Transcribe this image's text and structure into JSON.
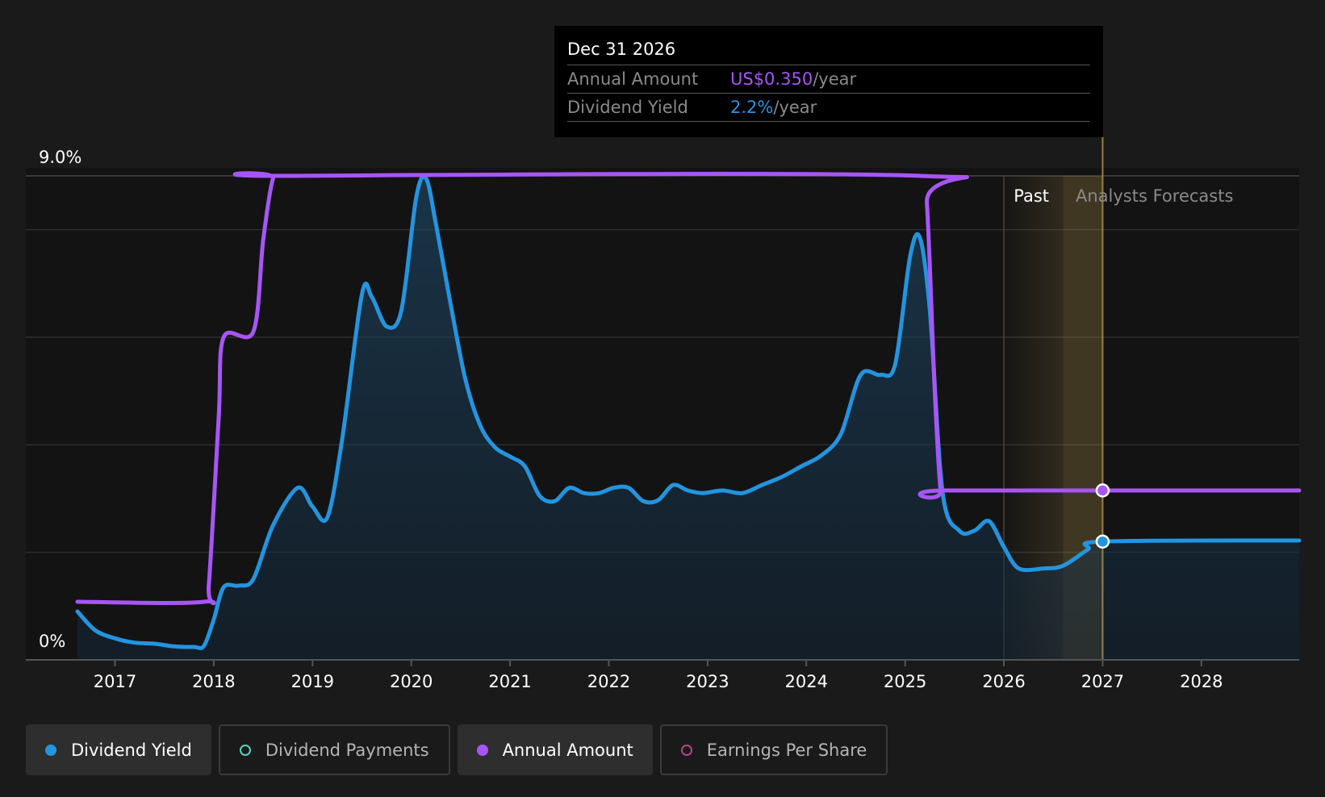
{
  "tooltip": {
    "date": "Dec 31 2026",
    "annual_label": "Annual Amount",
    "annual_value": "US$0.350",
    "annual_unit": "/year",
    "yield_label": "Dividend Yield",
    "yield_value": "2.2%",
    "yield_unit": "/year"
  },
  "regions": {
    "past_label": "Past",
    "forecast_label": "Analysts Forecasts"
  },
  "legend": [
    {
      "label": "Dividend Yield",
      "color": "#2394df",
      "filled": true,
      "active": true,
      "icon": "dividend-yield-dot-icon"
    },
    {
      "label": "Dividend Payments",
      "color": "#58d0be",
      "filled": false,
      "active": false,
      "icon": "dividend-payments-dot-icon"
    },
    {
      "label": "Annual Amount",
      "color": "#a855f7",
      "filled": true,
      "active": true,
      "icon": "annual-amount-dot-icon"
    },
    {
      "label": "Earnings Per Share",
      "color": "#b5497e",
      "filled": false,
      "active": false,
      "icon": "earnings-per-share-dot-icon"
    }
  ],
  "colors": {
    "yield": "#2394df",
    "annual": "#a855f7",
    "background": "#1a1a1a",
    "forecast_band": "#b6974e"
  },
  "chart_data": {
    "type": "line",
    "title": "",
    "xlabel": "",
    "ylabel": "",
    "xlim": [
      2016.62,
      2028.99
    ],
    "ylim": [
      0,
      9.0
    ],
    "y_ticks": [
      {
        "value": 9.0,
        "label": "9.0%"
      },
      {
        "value": 0,
        "label": "0%"
      }
    ],
    "gridlines": [
      2.0,
      4.0,
      6.0,
      8.0,
      9.0
    ],
    "x_ticks": [
      "2017",
      "2018",
      "2019",
      "2020",
      "2021",
      "2022",
      "2023",
      "2024",
      "2025",
      "2026",
      "2027",
      "2028"
    ],
    "past_start": 2026.0,
    "forecast_start": 2026.6,
    "cursor_x": 2027.0,
    "series": [
      {
        "name": "Dividend Yield",
        "color": "#2394df",
        "points": [
          [
            2016.62,
            0.9
          ],
          [
            2016.8,
            0.55
          ],
          [
            2017.0,
            0.4
          ],
          [
            2017.2,
            0.32
          ],
          [
            2017.4,
            0.3
          ],
          [
            2017.6,
            0.25
          ],
          [
            2017.8,
            0.24
          ],
          [
            2017.9,
            0.26
          ],
          [
            2018.0,
            0.75
          ],
          [
            2018.1,
            1.35
          ],
          [
            2018.25,
            1.38
          ],
          [
            2018.4,
            1.5
          ],
          [
            2018.6,
            2.5
          ],
          [
            2018.85,
            3.2
          ],
          [
            2019.0,
            2.85
          ],
          [
            2019.15,
            2.65
          ],
          [
            2019.3,
            4.1
          ],
          [
            2019.5,
            6.8
          ],
          [
            2019.6,
            6.75
          ],
          [
            2019.75,
            6.2
          ],
          [
            2019.9,
            6.5
          ],
          [
            2020.05,
            8.6
          ],
          [
            2020.15,
            8.95
          ],
          [
            2020.25,
            8.1
          ],
          [
            2020.4,
            6.6
          ],
          [
            2020.55,
            5.2
          ],
          [
            2020.7,
            4.35
          ],
          [
            2020.85,
            3.95
          ],
          [
            2021.0,
            3.78
          ],
          [
            2021.15,
            3.6
          ],
          [
            2021.3,
            3.05
          ],
          [
            2021.45,
            2.95
          ],
          [
            2021.6,
            3.2
          ],
          [
            2021.75,
            3.1
          ],
          [
            2021.9,
            3.1
          ],
          [
            2022.05,
            3.2
          ],
          [
            2022.2,
            3.2
          ],
          [
            2022.35,
            2.95
          ],
          [
            2022.5,
            2.97
          ],
          [
            2022.65,
            3.25
          ],
          [
            2022.8,
            3.15
          ],
          [
            2022.95,
            3.1
          ],
          [
            2023.15,
            3.15
          ],
          [
            2023.35,
            3.1
          ],
          [
            2023.55,
            3.25
          ],
          [
            2023.75,
            3.4
          ],
          [
            2023.95,
            3.6
          ],
          [
            2024.15,
            3.8
          ],
          [
            2024.35,
            4.2
          ],
          [
            2024.55,
            5.3
          ],
          [
            2024.75,
            5.3
          ],
          [
            2024.9,
            5.5
          ],
          [
            2025.05,
            7.5
          ],
          [
            2025.15,
            7.85
          ],
          [
            2025.25,
            6.5
          ],
          [
            2025.38,
            3.1
          ],
          [
            2025.55,
            2.4
          ],
          [
            2025.7,
            2.4
          ],
          [
            2025.85,
            2.58
          ],
          [
            2026.0,
            2.1
          ],
          [
            2026.15,
            1.7
          ],
          [
            2026.4,
            1.7
          ],
          [
            2026.6,
            1.75
          ],
          [
            2026.85,
            2.05
          ],
          [
            2027.0,
            2.2
          ],
          [
            2028.99,
            2.22
          ]
        ]
      },
      {
        "name": "Annual Amount",
        "color": "#a855f7",
        "points": [
          [
            2016.62,
            1.08
          ],
          [
            2017.9,
            1.08
          ],
          [
            2017.95,
            1.4
          ],
          [
            2018.05,
            4.5
          ],
          [
            2018.1,
            6.0
          ],
          [
            2018.4,
            6.1
          ],
          [
            2018.5,
            7.8
          ],
          [
            2018.6,
            8.95
          ],
          [
            2018.7,
            9.0
          ],
          [
            2025.15,
            9.0
          ],
          [
            2025.22,
            8.5
          ],
          [
            2025.3,
            5.0
          ],
          [
            2025.36,
            3.15
          ],
          [
            2025.42,
            3.15
          ],
          [
            2028.99,
            3.15
          ]
        ]
      }
    ],
    "markers": [
      {
        "series": "Annual Amount",
        "x": 2027.0,
        "y": 3.15
      },
      {
        "series": "Dividend Yield",
        "x": 2027.0,
        "y": 2.2
      }
    ]
  }
}
